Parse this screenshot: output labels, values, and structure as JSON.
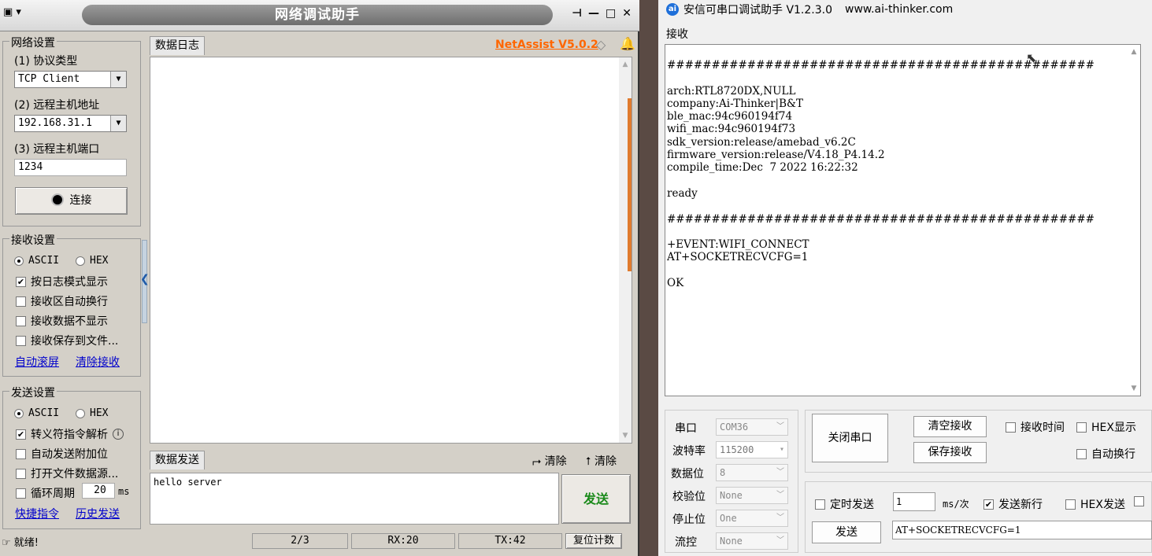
{
  "netassist": {
    "title": "网络调试助手",
    "brand": "NetAssist V5.0.2",
    "net_settings": {
      "group_title": "网络设置",
      "protocol_label": "(1) 协议类型",
      "protocol_value": "TCP Client",
      "host_label": "(2) 远程主机地址",
      "host_value": "192.168.31.1",
      "port_label": "(3) 远程主机端口",
      "port_value": "1234",
      "connect_label": "连接"
    },
    "recv_settings": {
      "group_title": "接收设置",
      "ascii": "ASCII",
      "hex": "HEX",
      "opt1": "按日志模式显示",
      "opt2": "接收区自动换行",
      "opt3": "接收数据不显示",
      "opt4": "接收保存到文件...",
      "link1": "自动滚屏",
      "link2": "清除接收"
    },
    "send_settings": {
      "group_title": "发送设置",
      "ascii": "ASCII",
      "hex": "HEX",
      "opt1": "转义符指令解析",
      "opt2": "自动发送附加位",
      "opt3": "打开文件数据源...",
      "opt4": "循环周期",
      "cycle_value": "20",
      "cycle_unit": "ms",
      "link1": "快捷指令",
      "link2": "历史发送"
    },
    "log_tab": "数据日志",
    "send_tab": "数据发送",
    "clear1": "清除",
    "clear2": "清除",
    "send_text": "hello server",
    "send_button": "发送",
    "status": {
      "ready": "就绪!",
      "count": "2/3",
      "rx": "RX:20",
      "tx": "TX:42",
      "reset": "复位计数"
    }
  },
  "aithinker": {
    "title": "安信可串口调试助手 V1.2.3.0",
    "url": "www.ai-thinker.com",
    "logo": "ai",
    "recv_label": "接收",
    "recv_lines": [
      "################################################",
      "",
      "arch:RTL8720DX,NULL",
      "company:Ai-Thinker|B&T",
      "ble_mac:94c960194f74",
      "wifi_mac:94c960194f73",
      "sdk_version:release/amebad_v6.2C",
      "firmware_version:release/V4.18_P4.14.2",
      "compile_time:Dec  7 2022 16:22:32",
      "",
      "ready",
      "",
      "################################################",
      "",
      "+EVENT:WIFI_CONNECT",
      "AT+SOCKETRECVCFG=1",
      "",
      "OK"
    ],
    "serial": {
      "port_label": "串口",
      "port_value": "COM36",
      "baud_label": "波特率",
      "baud_value": "115200",
      "data_label": "数据位",
      "data_value": "8",
      "parity_label": "校验位",
      "parity_value": "None",
      "stop_label": "停止位",
      "stop_value": "One",
      "flow_label": "流控",
      "flow_value": "None"
    },
    "close_port": "关闭串口",
    "clear_recv": "清空接收",
    "save_recv": "保存接收",
    "recv_time": "接收时间",
    "hex_display": "HEX显示",
    "auto_wrap": "自动换行",
    "timed_send": "定时发送",
    "interval_value": "1",
    "interval_unit": "ms/次",
    "send_newline": "发送新行",
    "hex_send": "HEX发送",
    "send_button": "发送",
    "send_input": "AT+SOCKETRECVCFG=1"
  }
}
